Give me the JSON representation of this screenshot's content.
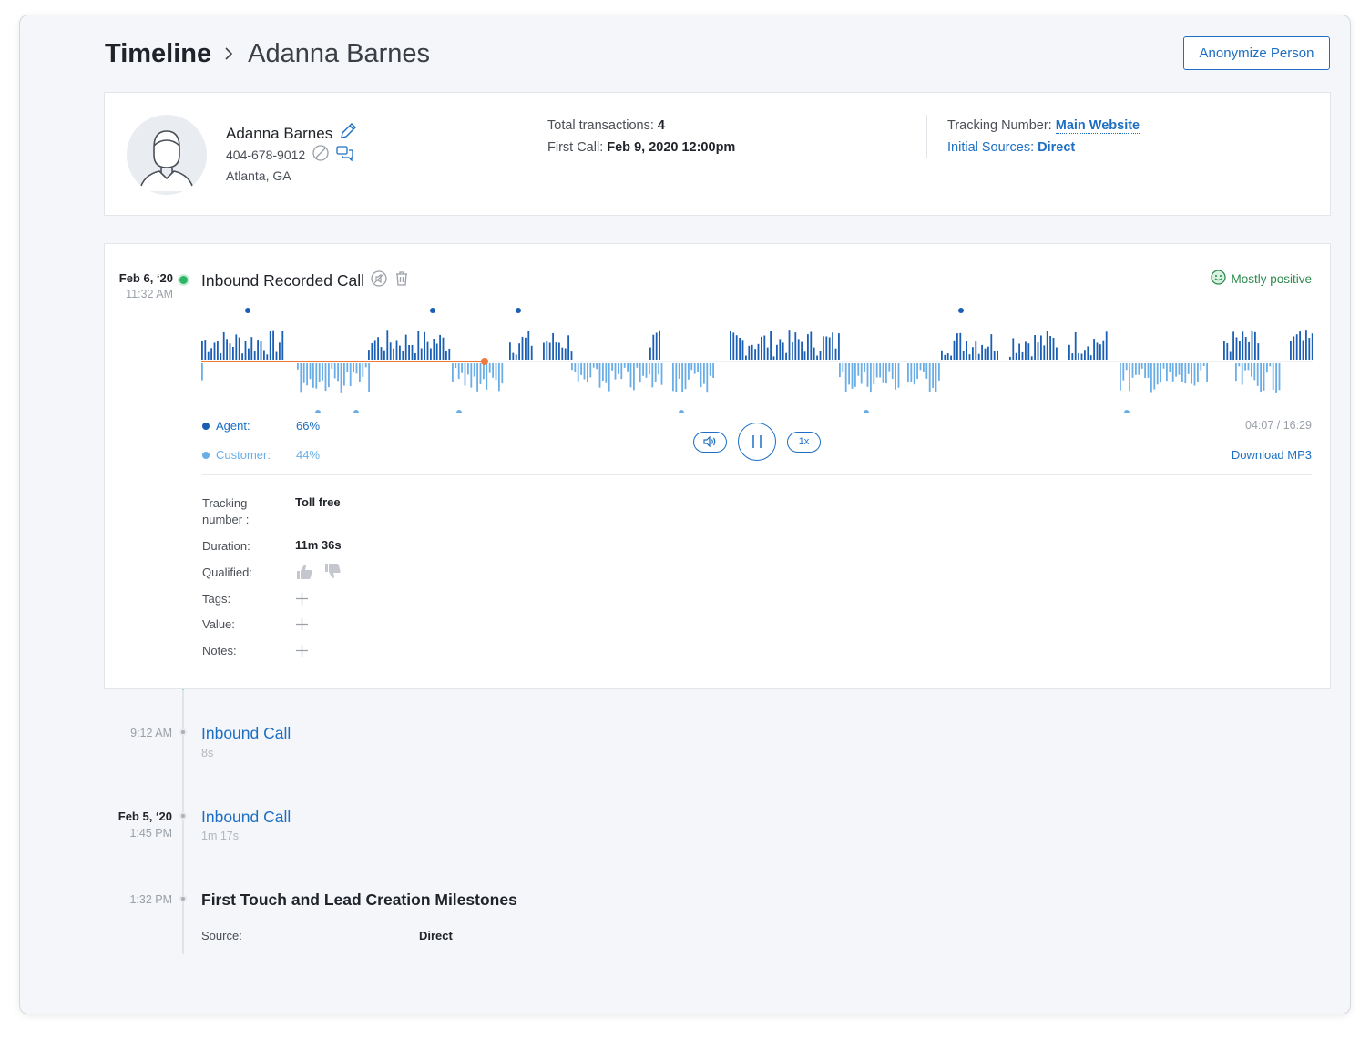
{
  "header": {
    "crumb_root": "Timeline",
    "crumb_person": "Adanna Barnes",
    "anonymize_label": "Anonymize Person"
  },
  "profile": {
    "name": "Adanna Barnes",
    "phone": "404-678-9012",
    "city": "Atlanta, GA",
    "total_transactions_label": "Total transactions:",
    "total_transactions": "4",
    "first_call_label": "First Call:",
    "first_call": "Feb 9, 2020 12:00pm",
    "tracking_number_label": "Tracking Number:",
    "tracking_number": "Main Website",
    "initial_sources_label": "Initial Sources:",
    "initial_sources": "Direct"
  },
  "recorded_call": {
    "date": "Feb 6, ‘20",
    "time": "11:32 AM",
    "title": "Inbound Recorded Call",
    "sentiment": "Mostly positive",
    "agent_label": "Agent:",
    "agent_pct": "66%",
    "customer_label": "Customer:",
    "customer_pct": "44%",
    "progress": 0.255,
    "elapsed": "04:07 / 16:29",
    "speed": "1x",
    "download_label": "Download MP3",
    "details": {
      "tracking_label": "Tracking number :",
      "tracking_value": "Toll free",
      "duration_label": "Duration:",
      "duration_value": "11m 36s",
      "qualified_label": "Qualified:",
      "tags_label": "Tags:",
      "value_label": "Value:",
      "notes_label": "Notes:"
    }
  },
  "events": [
    {
      "date": "",
      "time": "9:12 AM",
      "title": "Inbound Call",
      "sub": "8s"
    },
    {
      "date": "Feb 5, ‘20",
      "time": "1:45 PM",
      "title": "Inbound Call",
      "sub": "1m 17s"
    }
  ],
  "milestone": {
    "time": "1:32 PM",
    "title": "First Touch and Lead Creation Milestones",
    "source_label": "Source:",
    "source_value": "Direct"
  },
  "colors": {
    "accent": "#1d6fc4",
    "agent": "#1a5fb4",
    "customer": "#6aaee8",
    "progress": "#f07a3c",
    "timeline_active": "#2fb466",
    "sentiment": "#2e8b4e"
  },
  "icons": [
    "chevron-right-icon",
    "pencil-icon",
    "block-icon",
    "chat-icon",
    "no-sound-icon",
    "trash-icon",
    "smile-icon",
    "volume-icon",
    "pause-icon",
    "thumbs-up-icon",
    "thumbs-down-icon",
    "plus-icon"
  ]
}
